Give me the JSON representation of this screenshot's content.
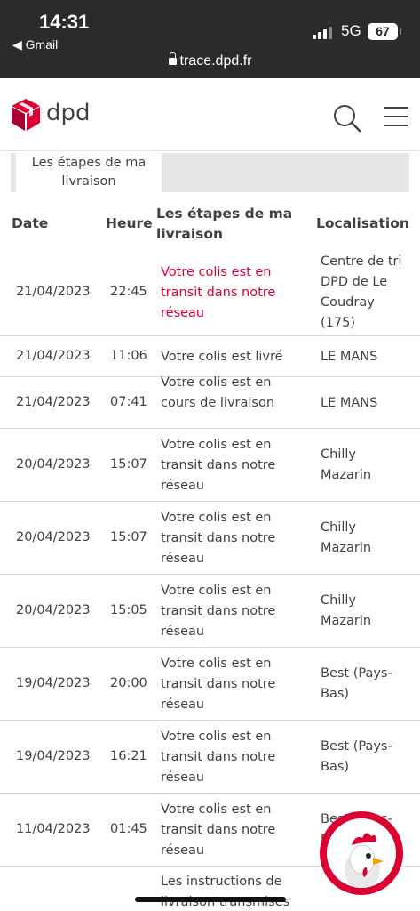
{
  "status_bar": {
    "time": "14:31",
    "back_label": "◀ Gmail",
    "network": "5G",
    "battery": "67",
    "url": "trace.dpd.fr"
  },
  "header": {
    "logo_text": "dpd",
    "logo_color": "#dc0032",
    "search_icon": "search-icon",
    "menu_icon": "hamburger-menu-icon"
  },
  "tabs": [
    {
      "label": "Les étapes de ma livraison",
      "active": true
    }
  ],
  "table": {
    "headers": {
      "date": "Date",
      "time": "Heure",
      "step": "Les étapes de ma livraison",
      "location": "Localisation"
    },
    "rows": [
      {
        "date": "21/04/2023",
        "time": "22:45",
        "step": "Votre colis est en transit dans notre réseau",
        "location": "Centre de tri DPD de Le Coudray (175)",
        "highlight": true
      },
      {
        "date": "21/04/2023",
        "time": "11:06",
        "step": "Votre colis est livré",
        "location": "LE MANS",
        "highlight": false
      },
      {
        "date": "21/04/2023",
        "time": "07:41",
        "step": "Votre colis est en cours de livraison",
        "location": "LE MANS",
        "highlight": false
      },
      {
        "date": "20/04/2023",
        "time": "15:07",
        "step": "Votre colis est en transit dans notre réseau",
        "location": "Chilly Mazarin",
        "highlight": false
      },
      {
        "date": "20/04/2023",
        "time": "15:07",
        "step": "Votre colis est en transit dans notre réseau",
        "location": "Chilly Mazarin",
        "highlight": false
      },
      {
        "date": "20/04/2023",
        "time": "15:05",
        "step": "Votre colis est en transit dans notre réseau",
        "location": "Chilly Mazarin",
        "highlight": false
      },
      {
        "date": "19/04/2023",
        "time": "20:00",
        "step": "Votre colis est en transit dans notre réseau",
        "location": "Best (Pays-Bas)",
        "highlight": false
      },
      {
        "date": "19/04/2023",
        "time": "16:21",
        "step": "Votre colis est en transit dans notre réseau",
        "location": "Best (Pays-Bas)",
        "highlight": false
      },
      {
        "date": "11/04/2023",
        "time": "01:45",
        "step": "Votre colis est en transit dans notre réseau",
        "location": "Best (Pays-Bas)",
        "highlight": false
      },
      {
        "date": "",
        "time": "",
        "step": "Les instructions de livraison transmises",
        "location": "",
        "highlight": false
      }
    ]
  }
}
